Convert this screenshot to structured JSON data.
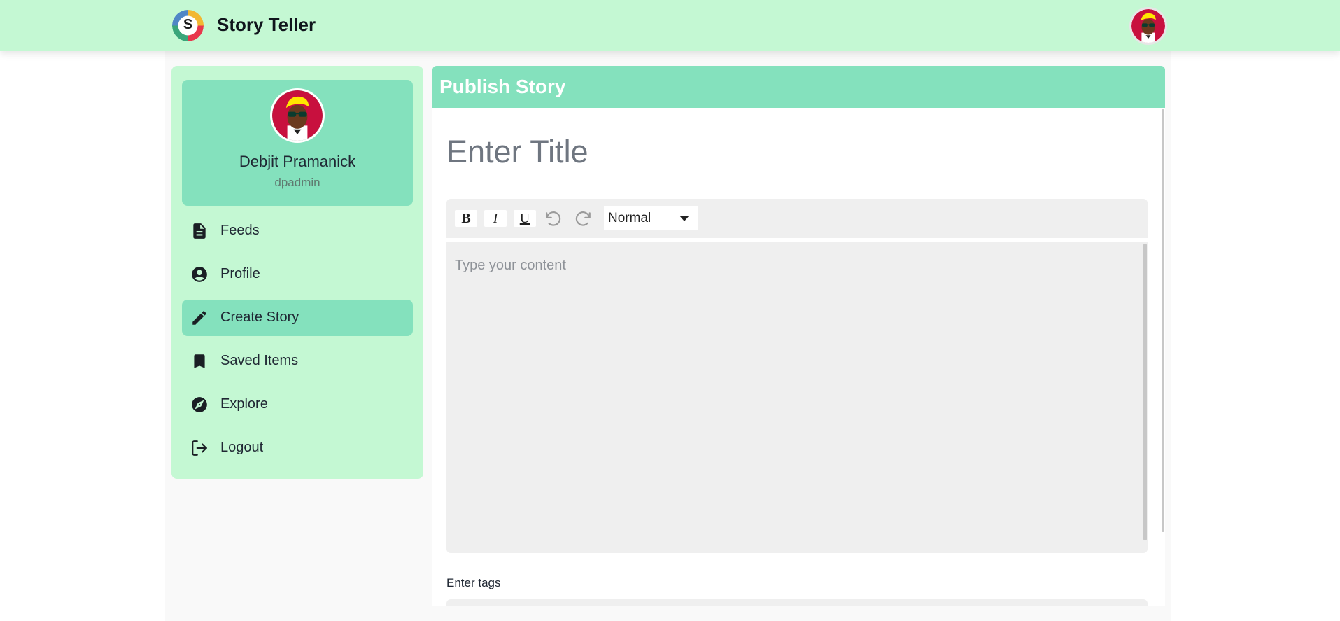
{
  "app": {
    "title": "Story Teller",
    "logo_letter": "S"
  },
  "user": {
    "name": "Debjit Pramanick",
    "username": "dpadmin"
  },
  "sidebar": {
    "items": [
      {
        "label": "Feeds",
        "icon": "document-icon",
        "active": false
      },
      {
        "label": "Profile",
        "icon": "account-circle-icon",
        "active": false
      },
      {
        "label": "Create Story",
        "icon": "pencil-icon",
        "active": true
      },
      {
        "label": "Saved Items",
        "icon": "bookmark-icon",
        "active": false
      },
      {
        "label": "Explore",
        "icon": "compass-icon",
        "active": false
      },
      {
        "label": "Logout",
        "icon": "logout-icon",
        "active": false
      }
    ]
  },
  "editor": {
    "header_title": "Publish Story",
    "title_placeholder": "Enter Title",
    "toolbar": {
      "bold": "B",
      "italic": "I",
      "underline": "U",
      "undo_icon": "undo-icon",
      "redo_icon": "redo-icon",
      "format_value": "Normal"
    },
    "content_placeholder": "Type your content",
    "tags_label": "Enter tags"
  },
  "colors": {
    "topbar": "#c4f8d3",
    "sidebar": "#c4f8d3",
    "accent": "#84e1bd",
    "editor_bg": "#efefef"
  }
}
